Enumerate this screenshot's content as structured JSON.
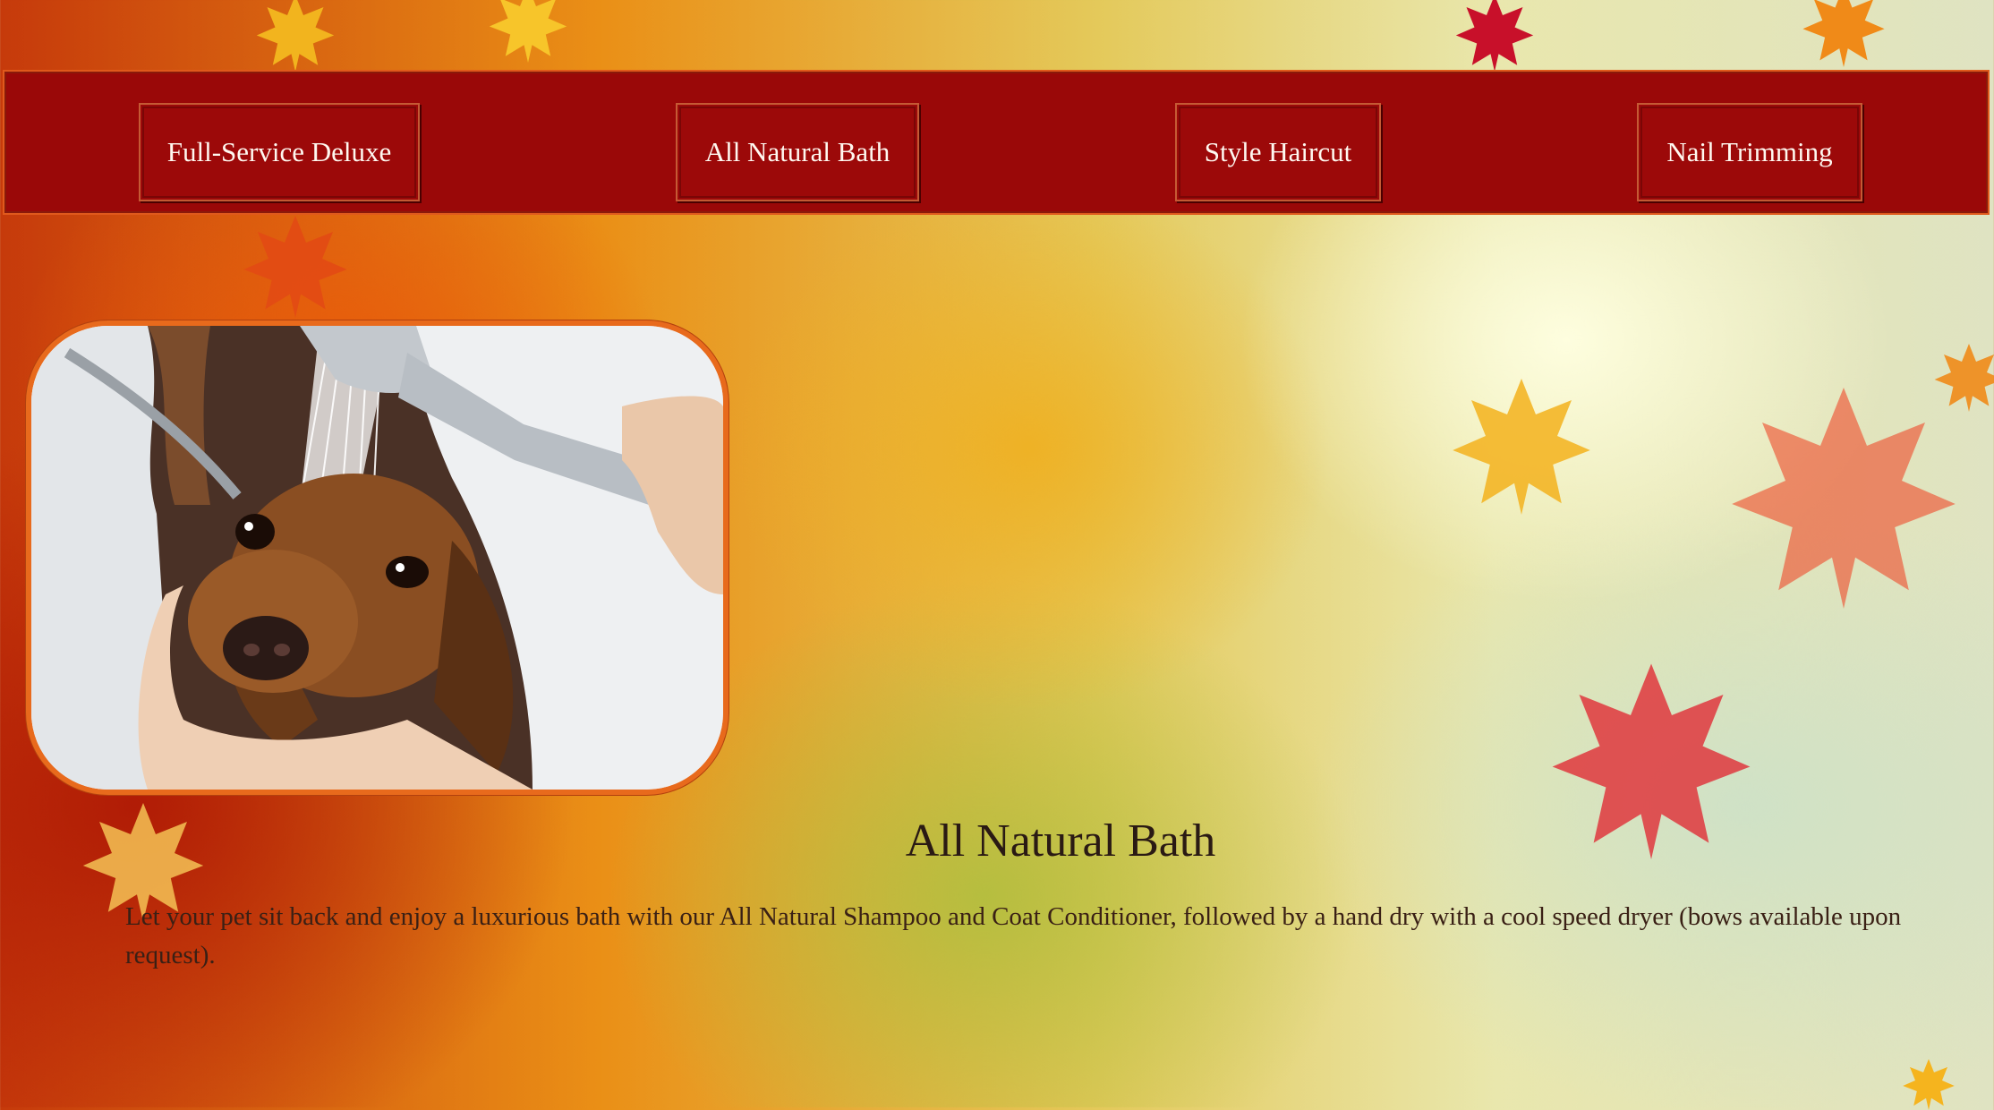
{
  "nav": {
    "items": [
      {
        "label": "Full-Service Deluxe"
      },
      {
        "label": "All Natural Bath"
      },
      {
        "label": "Style Haircut"
      },
      {
        "label": "Nail Trimming"
      }
    ]
  },
  "content": {
    "title": "All Natural Bath",
    "description": "Let your pet sit back and enjoy a luxurious bath with our All Natural Shampoo and Coat Conditioner, followed by a hand dry with a cool speed dryer (bows available upon request)."
  },
  "colors": {
    "nav_background": "#9a0808",
    "nav_border": "#e0591c",
    "photo_border": "#e86a1c",
    "heading_text": "#2a1a14"
  }
}
